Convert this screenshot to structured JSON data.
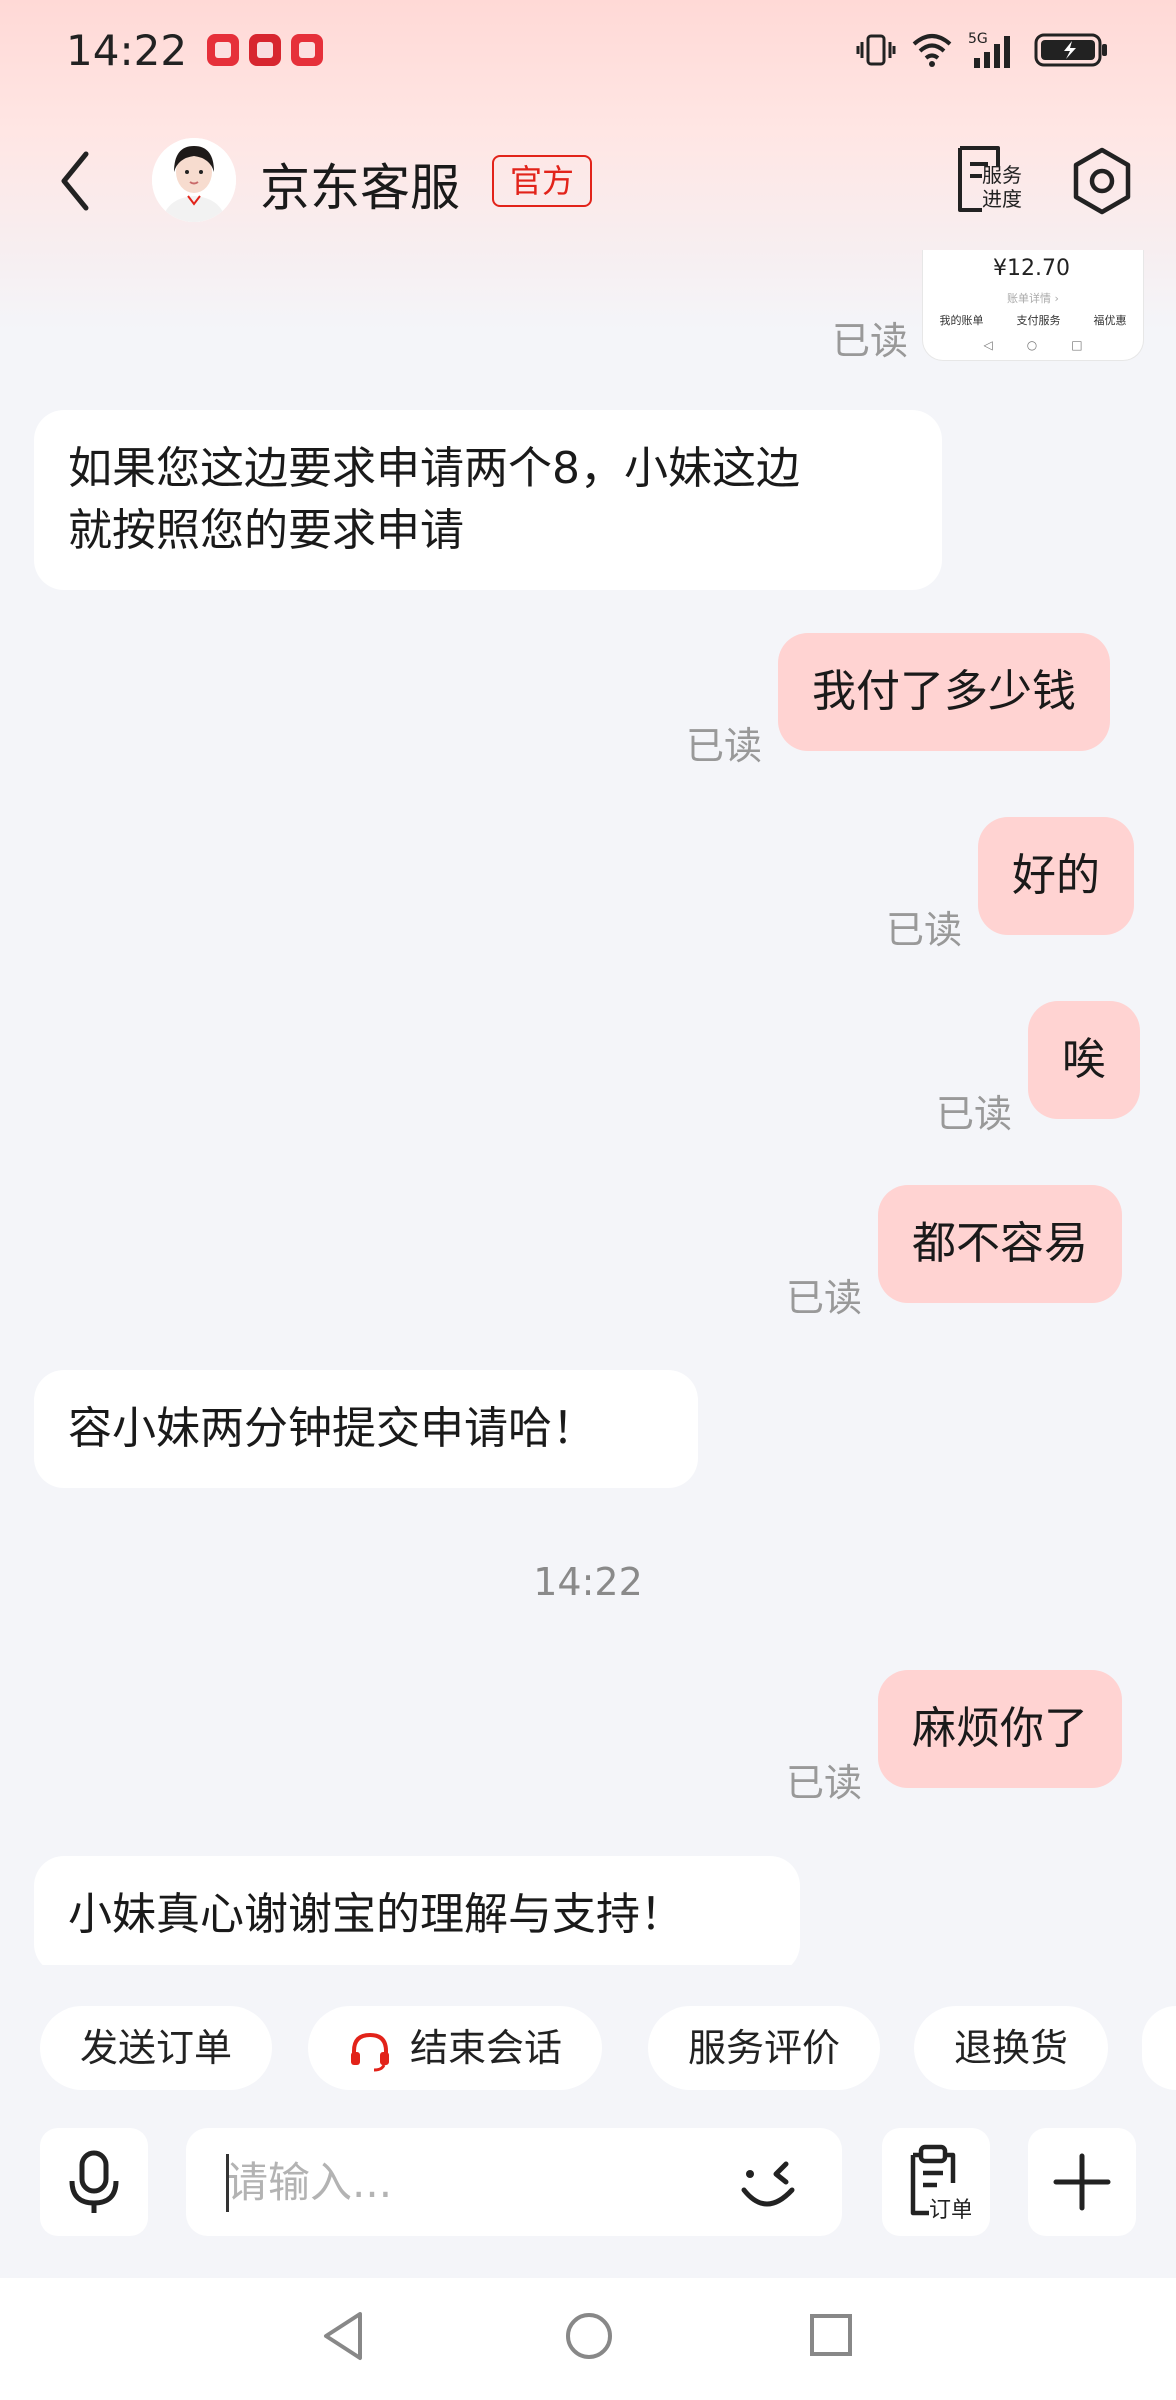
{
  "status_bar": {
    "time": "14:22",
    "network": "5G",
    "apps": [
      "app-icon-book",
      "app-icon-store",
      "app-icon-book2"
    ]
  },
  "header": {
    "title": "京东客服",
    "badge": "官方",
    "service_progress_line1": "服务",
    "service_progress_line2": "进度"
  },
  "thumbnail": {
    "amount": "¥12.70",
    "sub": "账单详情 ›",
    "items": [
      "我的账单",
      "支付服务",
      "福优惠"
    ]
  },
  "messages": [
    {
      "side": "in",
      "text1": "如果您这边要求申请两个8，小妹这边",
      "text2": "就按照您的要求申请"
    },
    {
      "side": "out",
      "text": "我付了多少钱",
      "read": "已读"
    },
    {
      "side": "out",
      "text": "好的",
      "read": "已读"
    },
    {
      "side": "out",
      "text": "唉",
      "read": "已读"
    },
    {
      "side": "out",
      "text": "都不容易",
      "read": "已读"
    },
    {
      "side": "in",
      "text": "容小妹两分钟提交申请哈！"
    },
    {
      "side": "out",
      "text": "麻烦你了",
      "read": "已读"
    },
    {
      "side": "in",
      "text": "小妹真心谢谢宝的理解与支持！"
    }
  ],
  "top_read": "已读",
  "time_separator": "14:22",
  "quick_actions": [
    "发送订单",
    "结束会话",
    "服务评价",
    "退换货"
  ],
  "input": {
    "placeholder": "请输入...",
    "order_label": "订单"
  },
  "colors": {
    "accent": "#e2231a",
    "outgoing_bubble": "#ffd3d2",
    "incoming_bubble": "#ffffff",
    "background": "#f4f5f9"
  }
}
